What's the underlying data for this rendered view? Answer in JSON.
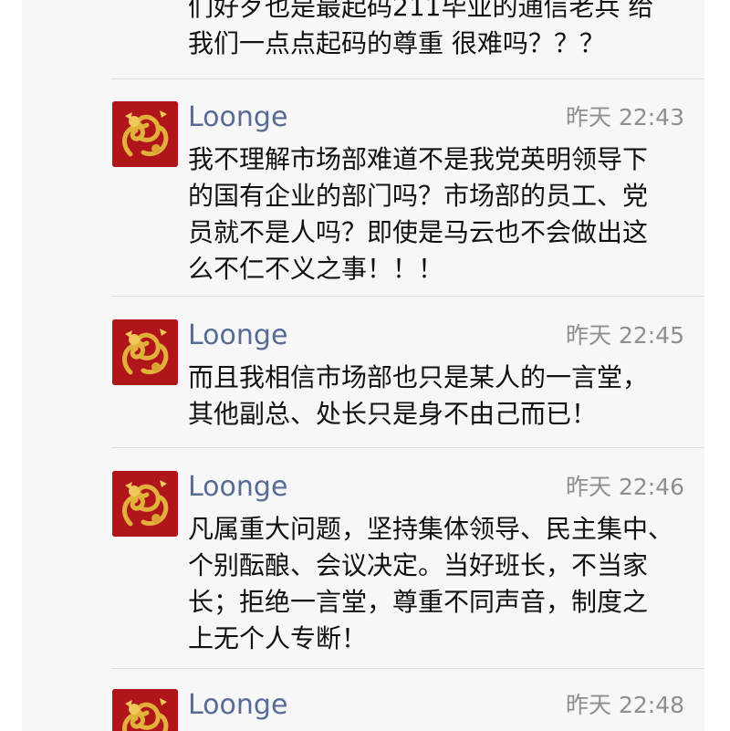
{
  "top_fragment": {
    "lines": [
      "们好歹也是最起码211毕业的通信老兵 给",
      "我们一点点起码的尊重 很难吗？？？"
    ]
  },
  "comments": [
    {
      "author": "Loonge",
      "time": "昨天 22:43",
      "lines": [
        "我不理解市场部难道不是我党英明领导下",
        "的国有企业的部门吗？市场部的员工、党",
        "员就不是人吗？即使是马云也不会做出这",
        "么不仁不义之事！！！"
      ]
    },
    {
      "author": "Loonge",
      "time": "昨天 22:45",
      "lines": [
        "而且我相信市场部也只是某人的一言堂，",
        "其他副总、处长只是身不由己而已！"
      ]
    },
    {
      "author": "Loonge",
      "time": "昨天 22:46",
      "lines": [
        "凡属重大问题，坚持集体领导、民主集中、",
        "个别酝酿、会议决定。当好班长，不当家",
        "长；拒绝一言堂，尊重不同声音，制度之",
        "上无个人专断！"
      ]
    },
    {
      "author": "Loonge",
      "time": "昨天 22:48",
      "lines": []
    }
  ],
  "avatar_icon": "golden-dragon-avatar",
  "colors": {
    "panel_bg": "#f7f7f7",
    "name": "#576b95",
    "time": "#8f8f8f",
    "avatar_bg": "#b0151a"
  }
}
